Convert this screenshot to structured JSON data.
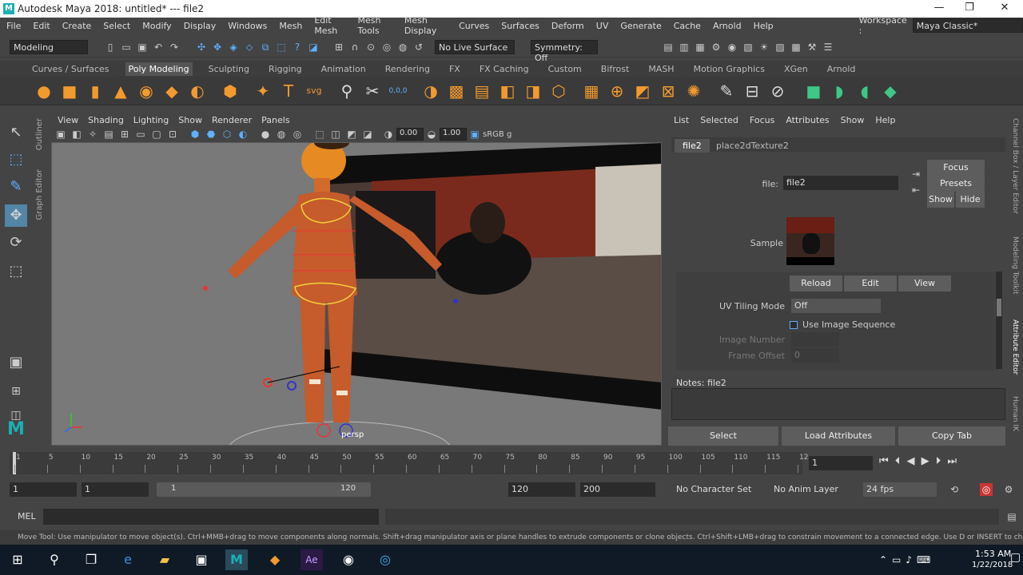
{
  "window": {
    "title": "Autodesk Maya 2018: untitled*   ---   file2",
    "logo": "M",
    "minimize": "—",
    "maximize": "❐",
    "close": "✕"
  },
  "menu": {
    "items": [
      "File",
      "Edit",
      "Create",
      "Select",
      "Modify",
      "Display",
      "Windows",
      "Mesh",
      "Edit Mesh",
      "Mesh Tools",
      "Mesh Display",
      "Curves",
      "Surfaces",
      "Deform",
      "UV",
      "Generate",
      "Cache",
      "Arnold",
      "Help"
    ],
    "workspace_label": "Workspace :",
    "workspace_value": "Maya Classic*"
  },
  "status_line": {
    "menuset": "Modeling",
    "live_surface": "No Live Surface",
    "symmetry": "Symmetry: Off"
  },
  "shelf": {
    "tabs": [
      "Curves / Surfaces",
      "Poly Modeling",
      "Sculpting",
      "Rigging",
      "Animation",
      "Rendering",
      "FX",
      "FX Caching",
      "Custom",
      "Bifrost",
      "MASH",
      "Motion Graphics",
      "XGen",
      "Arnold"
    ],
    "active_tab": "Poly Modeling",
    "text_tool": "T",
    "svg_tool": "svg",
    "coord_label": "0,0,0"
  },
  "side_tabs": {
    "outliner": "Outliner",
    "graph_editor": "Graph Editor"
  },
  "viewport": {
    "menu": [
      "View",
      "Shading",
      "Lighting",
      "Show",
      "Renderer",
      "Panels"
    ],
    "exposure": "0.00",
    "gamma": "1.00",
    "color_space": "sRGB g",
    "camera_label": "persp"
  },
  "attribute_editor": {
    "menu": [
      "List",
      "Selected",
      "Focus",
      "Attributes",
      "Show",
      "Help"
    ],
    "tabs": [
      "file2",
      "place2dTexture2"
    ],
    "file_label": "file:",
    "file_value": "file2",
    "focus": "Focus",
    "presets": "Presets",
    "show": "Show",
    "hide": "Hide",
    "sample_label": "Sample",
    "reload": "Reload",
    "edit": "Edit",
    "view": "View",
    "uv_tiling_label": "UV Tiling Mode",
    "uv_tiling_value": "Off",
    "use_image_sequence": "Use Image Sequence",
    "image_number_label": "Image Number",
    "frame_offset_label": "Frame Offset",
    "frame_offset_value": "0",
    "notes_label": "Notes:  file2",
    "select": "Select",
    "load_attributes": "Load Attributes",
    "copy_tab": "Copy Tab"
  },
  "right_rail": [
    "Channel Box / Layer Editor",
    "Modeling Toolkit",
    "Attribute Editor",
    "Human IK"
  ],
  "timeline": {
    "ticks": [
      "1",
      "5",
      "10",
      "15",
      "20",
      "25",
      "30",
      "35",
      "40",
      "45",
      "50",
      "55",
      "60",
      "65",
      "70",
      "75",
      "80",
      "85",
      "90",
      "95",
      "100",
      "105",
      "110",
      "115",
      "12"
    ],
    "current_frame": "1"
  },
  "range": {
    "start": "1",
    "start2": "1",
    "slider_start": "1",
    "slider_end": "120",
    "end": "120",
    "end2": "200",
    "character_set": "No Character Set",
    "anim_layer": "No Anim Layer",
    "fps": "24 fps"
  },
  "command_line": {
    "label": "MEL"
  },
  "help_line": "Move Tool: Use manipulator to move object(s). Ctrl+MMB+drag to move components along normals. Shift+drag manipulator axis or plane handles to extrude components or clone objects. Ctrl+Shift+LMB+drag to constrain movement to a connected edge. Use D or INSERT to change the pivot position a",
  "taskbar": {
    "time": "1:53 AM",
    "date": "1/22/2018"
  }
}
